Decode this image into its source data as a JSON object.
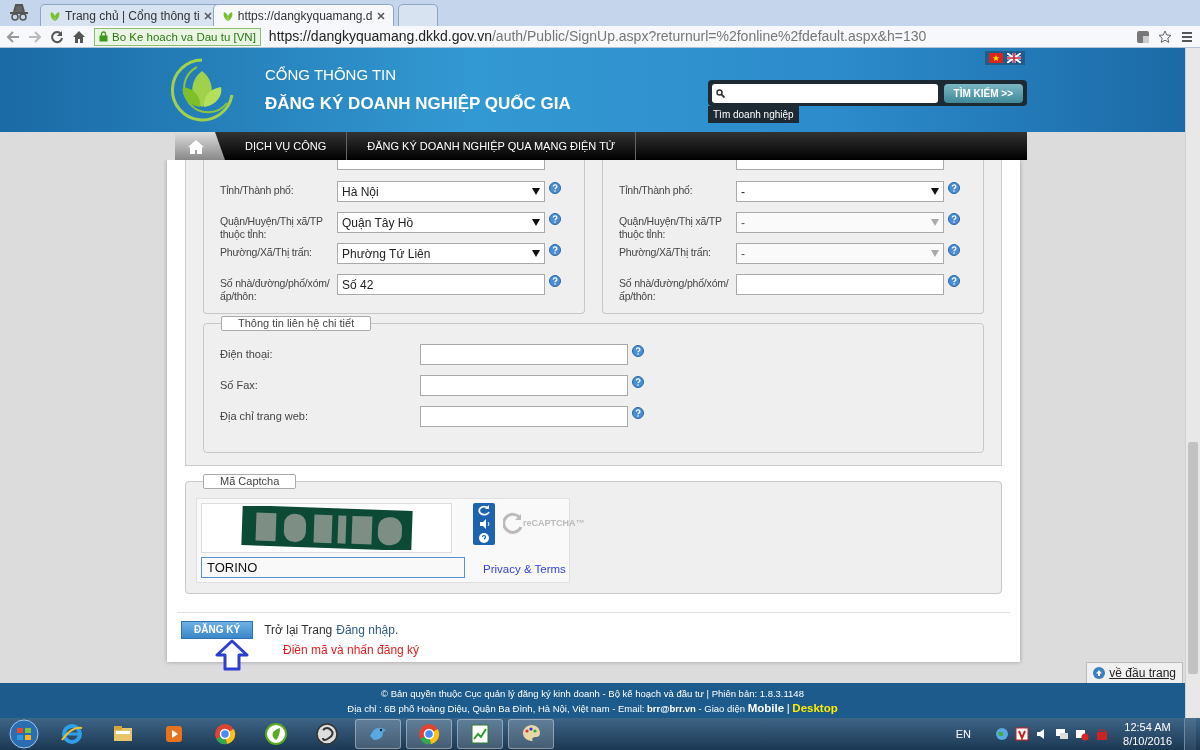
{
  "browser": {
    "tabs": [
      {
        "title": "Trang chủ | Cổng thông ti",
        "selected": false
      },
      {
        "title": "https://dangkyquamang.d",
        "selected": true
      }
    ],
    "site_badge": "Bo Ke hoach va Dau tu [VN]",
    "url_host": "https://dangkyquamang.dkkd.gov.vn",
    "url_path": "/auth/Public/SignUp.aspx?returnurl=%2fonline%2fdefault.aspx&h=130"
  },
  "header": {
    "subtitle": "CỔNG THÔNG TIN",
    "title": "ĐĂNG KÝ DOANH NGHIỆP QUỐC GIA",
    "search_button": "TÌM KIẾM >>",
    "search_tooltip": "Tìm doanh nghiệp"
  },
  "nav": {
    "items": [
      "DỊCH VỤ CÔNG",
      "ĐĂNG KÝ DOANH NGHIỆP QUA MẠNG ĐIỆN TỬ"
    ]
  },
  "address_columns": [
    {
      "fields": [
        {
          "kind": "text"
        },
        {
          "label": "Tỉnh/Thành phố:",
          "kind": "select",
          "value": "Hà Nội",
          "disabled": false
        },
        {
          "label": "Quận/Huyện/Thị xã/TP thuộc tỉnh:",
          "kind": "select",
          "value": "Quận Tây Hồ",
          "disabled": false
        },
        {
          "label": "Phường/Xã/Thị trấn:",
          "kind": "select",
          "value": "Phường Tứ Liên",
          "disabled": false
        },
        {
          "label": "Số nhà/đường/phố/xóm/ấp/thôn:",
          "kind": "text",
          "value": "Số 42"
        }
      ]
    },
    {
      "fields": [
        {
          "kind": "text"
        },
        {
          "label": "Tỉnh/Thành phố:",
          "kind": "select",
          "value": "-",
          "disabled": false
        },
        {
          "label": "Quận/Huyện/Thị xã/TP thuộc tỉnh:",
          "kind": "select",
          "value": "-",
          "disabled": true
        },
        {
          "label": "Phường/Xã/Thị trấn:",
          "kind": "select",
          "value": "-",
          "disabled": true
        },
        {
          "label": "Số nhà/đường/phố/xóm/ấp/thôn:",
          "kind": "text"
        }
      ]
    }
  ],
  "contact": {
    "legend": "Thông tin liên hệ chi tiết",
    "fields": [
      {
        "label": "Điện thoại:"
      },
      {
        "label": "Số Fax:"
      },
      {
        "label": "Địa chỉ trang web:"
      }
    ]
  },
  "captcha": {
    "legend": "Mã Captcha",
    "value": "TORINO",
    "logo_text": "reCAPTCHA™",
    "privacy_link": "Privacy & Terms"
  },
  "actions": {
    "submit": "ĐĂNG KÝ",
    "back_text": "Trở lại Trang",
    "back_link": "Đăng nhập.",
    "hint": "Điền mã và nhấn đăng ký"
  },
  "back_to_top": "về đầu trang",
  "footer": {
    "line_1": "© Bản quyền thuộc Cục quản lý đăng ký kinh doanh - Bộ kế hoạch và đầu tư | Phiên bản: 1.8.3.1148",
    "line_2": "Địa chỉ : 6B phố Hoàng Diệu, Quận Ba Đình, Hà Nội, Việt nam - Email: **brr@brr.vn** - Giao diện",
    "mobile_link": "Mobile",
    "separator": "|",
    "desktop_link": "Desktop"
  },
  "taskbar": {
    "language": "EN",
    "time": "12:54 AM",
    "date": "8/10/2016"
  }
}
